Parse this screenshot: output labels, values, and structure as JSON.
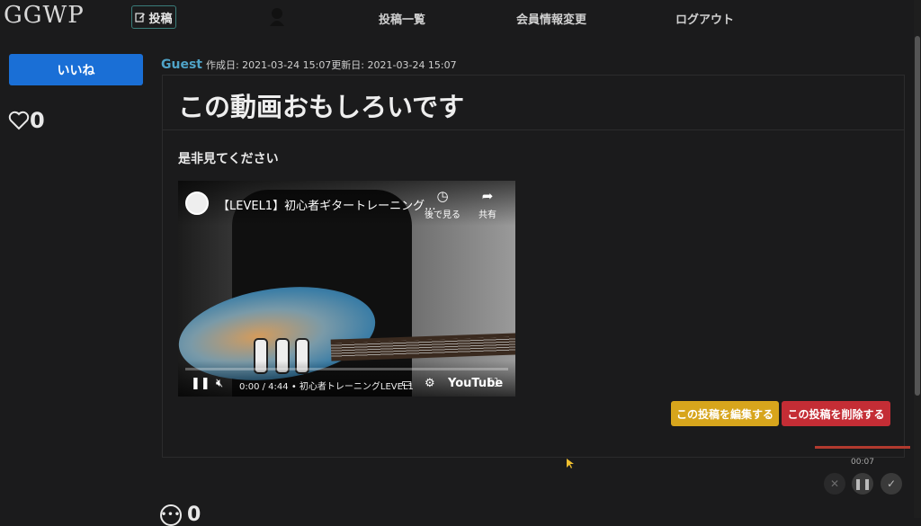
{
  "nav": {
    "brand": "GGWP",
    "post_label": "投稿",
    "links": [
      "投稿一覧",
      "会員情報変更",
      "ログアウト"
    ]
  },
  "sidebar": {
    "like_button": "いいね",
    "like_count": "0"
  },
  "post": {
    "author": "Guest",
    "meta": "作成日: 2021-03-24 15:07更新日: 2021-03-24 15:07",
    "title": "この動画おもしろいです",
    "body": "是非見てください",
    "edit_button": "この投稿を編集する",
    "delete_button": "この投稿を削除する"
  },
  "video": {
    "title": "【LEVEL1】初心者ギタートレーニング...",
    "watch_later": "後で見る",
    "share": "共有",
    "time": "0:00 / 4:44 • 初心者トレーニングLEVEL1",
    "youtube_label": "YouTube"
  },
  "recorder": {
    "time": "00:07"
  },
  "comments": {
    "count": "0"
  },
  "colors": {
    "accent": "#1a6fd6",
    "edit": "#d7a51c",
    "delete": "#c42d35",
    "author": "#4fa3c7",
    "background": "#1b1b1c"
  }
}
